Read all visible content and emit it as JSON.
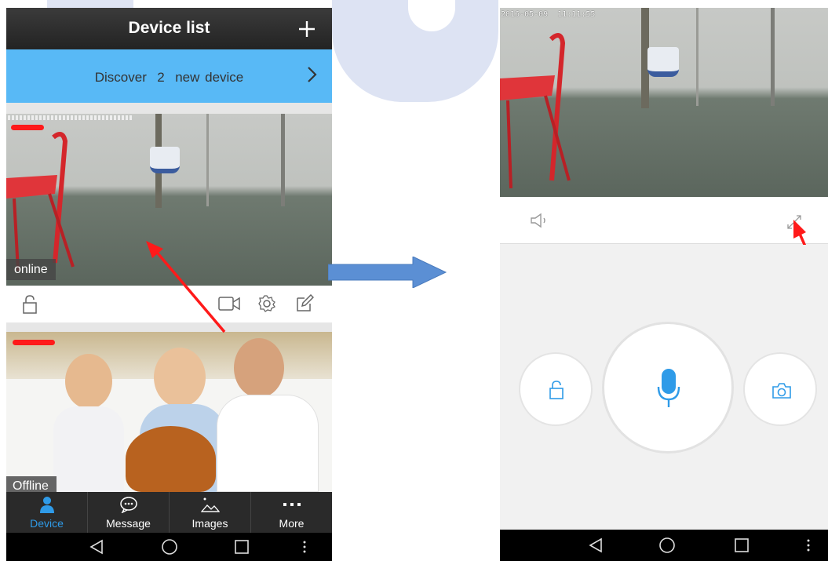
{
  "left_phone": {
    "header": {
      "title": "Device list",
      "add_icon": "plus-icon"
    },
    "discover_banner": {
      "text": "Discover  2  new device",
      "arrow_icon": "chevron-right-icon"
    },
    "devices": [
      {
        "status": "online",
        "actions": [
          "unlock-icon",
          "video-icon",
          "settings-icon",
          "edit-icon"
        ]
      },
      {
        "status": "Offline"
      }
    ],
    "tabs": [
      {
        "label": "Device",
        "icon": "person-icon",
        "active": true
      },
      {
        "label": "Message",
        "icon": "chat-bubble-icon",
        "active": false
      },
      {
        "label": "Images",
        "icon": "image-icon",
        "active": false
      },
      {
        "label": "More",
        "icon": "more-dots-icon",
        "active": false
      }
    ]
  },
  "right_phone": {
    "video_timestamp": "2016-05-09  11:11:55",
    "controls": {
      "speaker_icon": "speaker-icon",
      "fullscreen_icon": "fullscreen-icon"
    },
    "action_buttons": [
      "unlock-icon",
      "microphone-icon",
      "camera-icon"
    ]
  },
  "colors": {
    "header_bg": "#2b2b2b",
    "discover_bg": "#58b9f6",
    "active_tab": "#2f9be8",
    "annotation_arrow": "#ff1a1a",
    "flow_arrow": "#5b8fd4",
    "mic_blue": "#2f9be8"
  }
}
